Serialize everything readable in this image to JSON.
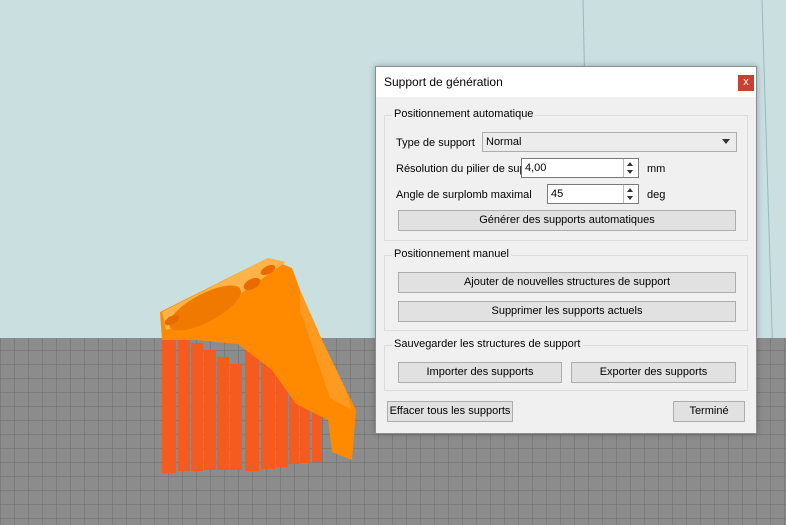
{
  "dialog": {
    "title": "Support de génération",
    "close_label": "x",
    "auto": {
      "title": "Positionnement automatique",
      "type_label": "Type de support",
      "type_value": "Normal",
      "resolution_label": "Résolution du pilier de support",
      "resolution_value": "4,00",
      "resolution_unit": "mm",
      "angle_label": "Angle de surplomb maximal",
      "angle_value": "45",
      "angle_unit": "deg",
      "generate_button": "Générer des supports automatiques"
    },
    "manual": {
      "title": "Positionnement manuel",
      "add_button": "Ajouter de nouvelles structures de support",
      "remove_button": "Supprimer les supports actuels"
    },
    "save": {
      "title": "Sauvegarder les structures de support",
      "import_button": "Importer des supports",
      "export_button": "Exporter des supports"
    },
    "clear_all_button": "Effacer tous les supports",
    "done_button": "Terminé"
  },
  "colors": {
    "model_orange": "#ff8a00",
    "support_orange": "#f55a1e",
    "bed_gray": "#8f8f8f",
    "background": "#c9dfe0"
  }
}
